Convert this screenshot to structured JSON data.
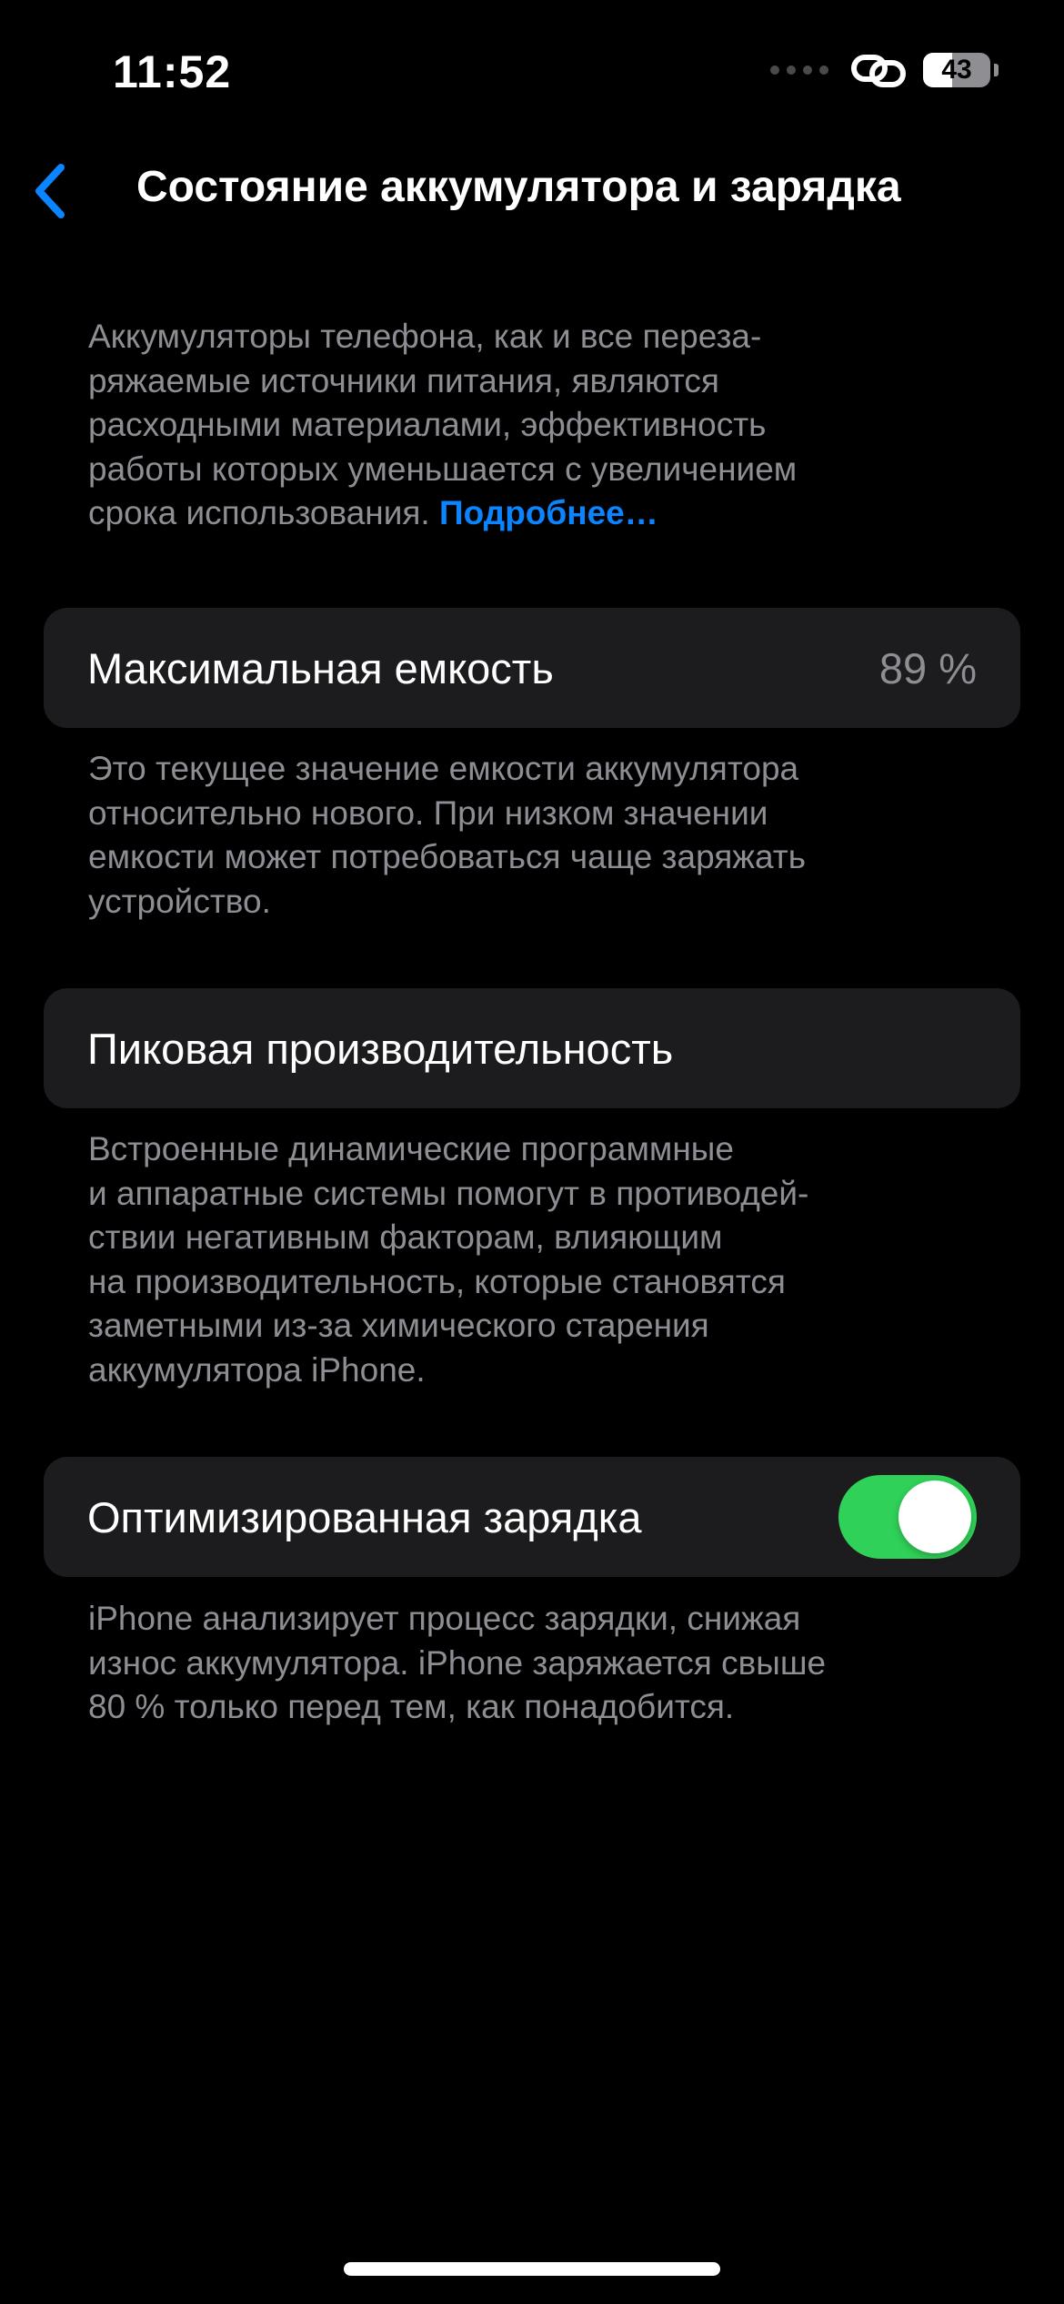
{
  "status_bar": {
    "time": "11:52",
    "battery_level": "43",
    "battery_fraction": 0.43,
    "icons": [
      "signal-dots-icon",
      "link-icon",
      "battery-icon"
    ]
  },
  "nav": {
    "back_icon": "chevron-left-icon",
    "title": "Состояние аккумулятора и зарядка"
  },
  "intro": {
    "text": "Аккумуляторы телефона, как и все переза-\nряжаемые источники питания, являются\nрасходными материалами, эффективность\nработы которых уменьшается с увеличением\nсрока использования. ",
    "link": "Подробнее…"
  },
  "max_capacity": {
    "label": "Максимальная емкость",
    "value": "89 %",
    "description": "Это текущее значение емкости аккумулятора\nотносительно нового. При низком значении\nемкости может потребоваться чаще заряжать\nустройство."
  },
  "peak_performance": {
    "label": "Пиковая производительность",
    "description": "Встроенные динамические программные\nи аппаратные системы помогут в противодей-\nствии негативным факторам, влияющим\nна производительность, которые становятся\nзаметными из-за химического старения\nаккумулятора iPhone."
  },
  "optimized_charging": {
    "label": "Оптимизированная зарядка",
    "enabled": true,
    "description": "iPhone анализирует процесс зарядки, снижая\nизнос аккумулятора. iPhone заряжается свыше\n80 % только перед тем, как понадобится."
  },
  "colors": {
    "background": "#000000",
    "cell": "#1c1c1e",
    "secondary_text": "#8d8d93",
    "link": "#0a84ff",
    "toggle_on": "#30d158"
  }
}
